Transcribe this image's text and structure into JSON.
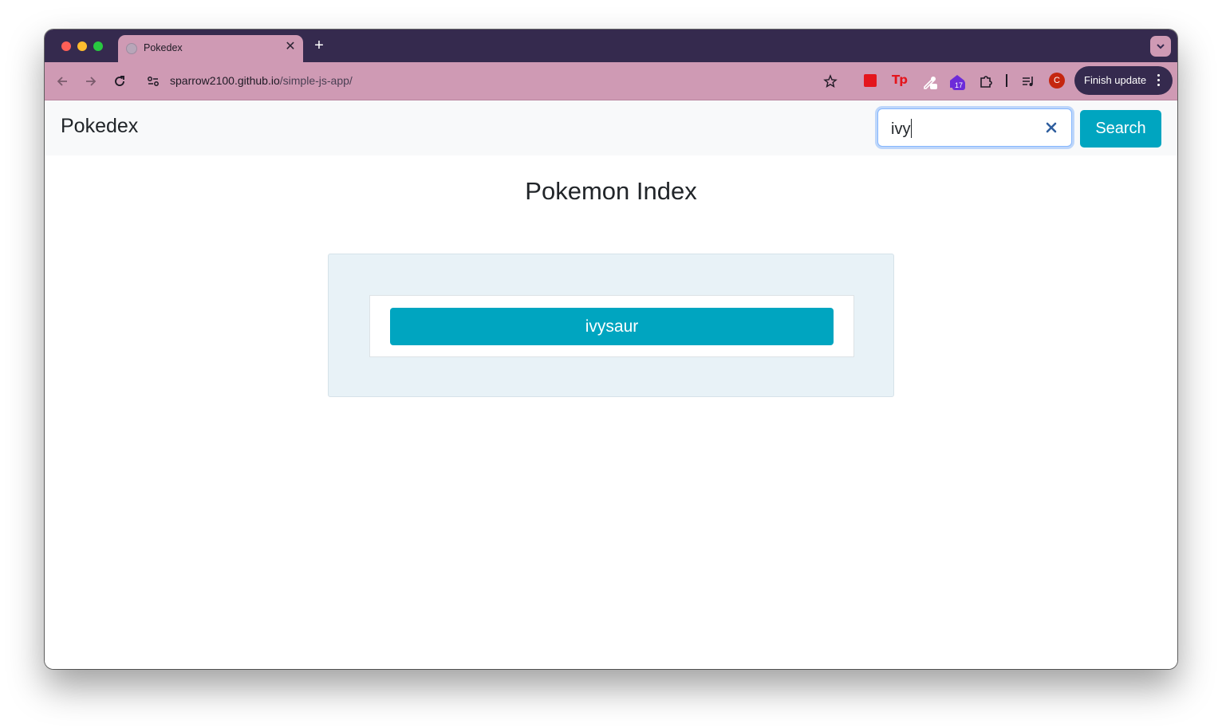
{
  "browser": {
    "tab": {
      "title": "Pokedex"
    },
    "new_tab_label": "+",
    "address": {
      "host": "sparrow2100.github.io",
      "path": "/simple-js-app/"
    },
    "extensions": {
      "tp_label": "Tp",
      "badge_count": "17"
    },
    "profile_initial": "C",
    "finish_update_label": "Finish update"
  },
  "navbar": {
    "brand": "Pokedex",
    "search": {
      "value": "ivy"
    },
    "search_button_label": "Search"
  },
  "main": {
    "title": "Pokemon Index",
    "pokemon_list": [
      {
        "name": "ivysaur"
      }
    ]
  },
  "colors": {
    "accent": "#00a5c0",
    "tab_strip": "#352a4e",
    "toolbar": "#cf9ab4"
  }
}
